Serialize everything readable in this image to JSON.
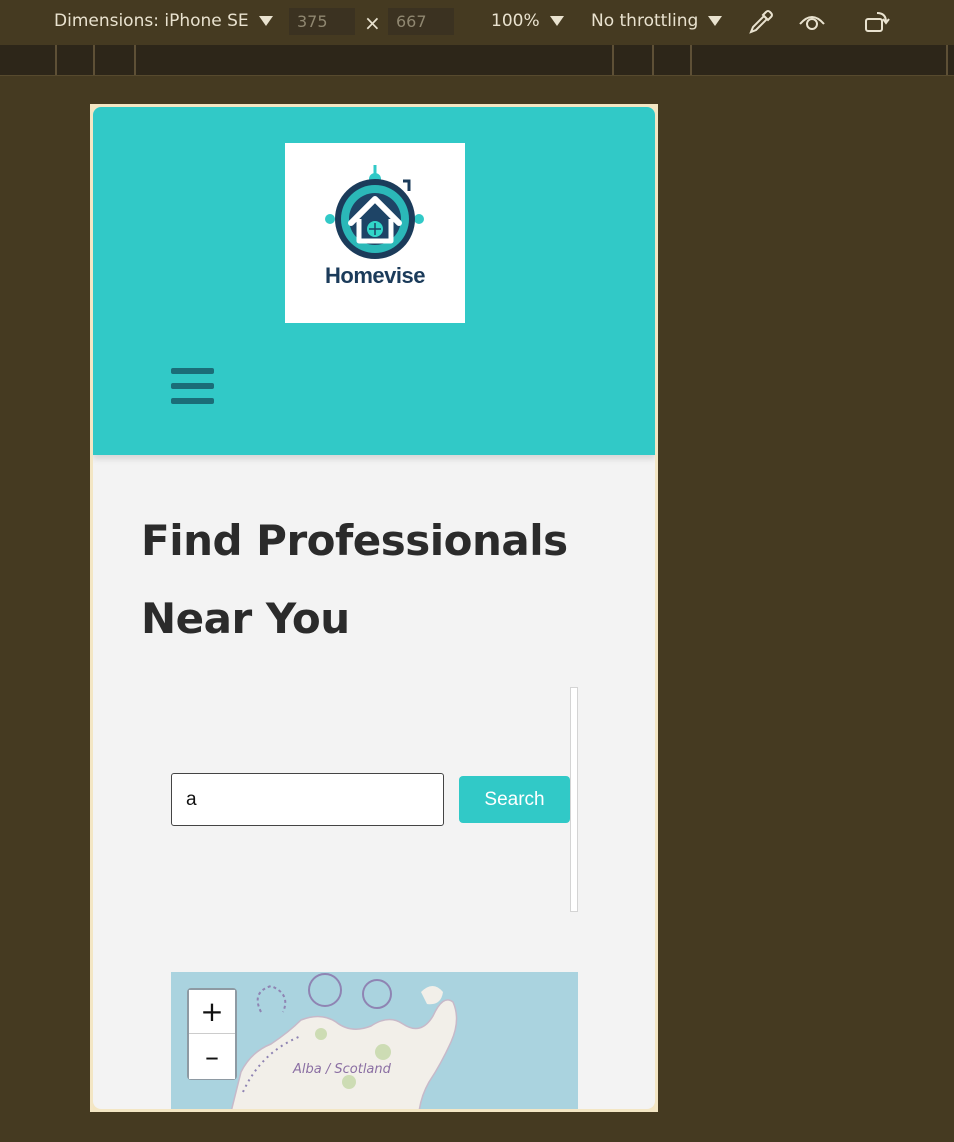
{
  "devtools": {
    "dimensions_label": "Dimensions: iPhone SE",
    "width": "375",
    "height": "667",
    "times": "×",
    "zoom": "100%",
    "throttling": "No throttling",
    "icons": [
      "eyedropper-icon",
      "eye-icon",
      "rotate-icon"
    ]
  },
  "header": {
    "brand": "Homevise",
    "menu_icon": "hamburger-icon",
    "accent_color": "#31c9c7"
  },
  "main": {
    "heading": "Find Professionals Near You",
    "search": {
      "value": "a",
      "button_label": "Search",
      "button_color": "#31c9c7"
    },
    "map": {
      "zoom_in": "+",
      "zoom_out": "–",
      "region_label": "Alba / Scotland"
    }
  }
}
